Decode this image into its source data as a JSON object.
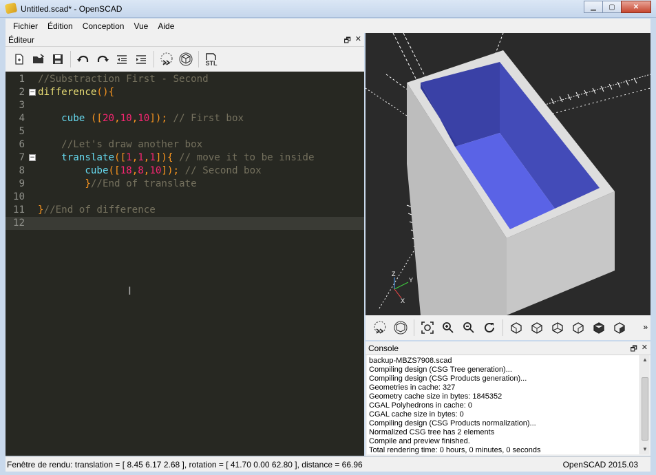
{
  "window": {
    "title": "Untitled.scad* - OpenSCAD",
    "minimize": "▁",
    "maximize": "▢",
    "close": "✕"
  },
  "menu": [
    "Fichier",
    "Édition",
    "Conception",
    "Vue",
    "Aide"
  ],
  "editor": {
    "title": "Éditeur",
    "float_icon": "🗗",
    "close_icon": "✕",
    "toolbar_icons": [
      "new-file-icon",
      "open-file-icon",
      "save-icon",
      "undo-icon",
      "redo-icon",
      "unindent-icon",
      "indent-icon",
      "preview-icon",
      "render-icon",
      "export-stl-icon"
    ],
    "stl_label": "STL",
    "lines": [
      {
        "n": "1",
        "parts": [
          [
            "c-com",
            "//Substraction First - Second"
          ]
        ]
      },
      {
        "n": "2",
        "fold": "−",
        "parts": [
          [
            "c-fn",
            "difference"
          ],
          [
            "c-br",
            "(){"
          ]
        ]
      },
      {
        "n": "3",
        "parts": []
      },
      {
        "n": "4",
        "parts": [
          [
            "c-op",
            "    "
          ],
          [
            "c-kw",
            "cube"
          ],
          [
            "c-op",
            " "
          ],
          [
            "c-br",
            "(["
          ],
          [
            "c-num",
            "20"
          ],
          [
            "c-br",
            ","
          ],
          [
            "c-num",
            "10"
          ],
          [
            "c-br",
            ","
          ],
          [
            "c-num",
            "10"
          ],
          [
            "c-br",
            "]);"
          ],
          [
            "c-op",
            " "
          ],
          [
            "c-com",
            "// First box"
          ]
        ]
      },
      {
        "n": "5",
        "parts": []
      },
      {
        "n": "6",
        "parts": [
          [
            "c-op",
            "    "
          ],
          [
            "c-com",
            "//Let's draw another box"
          ]
        ]
      },
      {
        "n": "7",
        "fold": "−",
        "parts": [
          [
            "c-op",
            "    "
          ],
          [
            "c-kw",
            "translate"
          ],
          [
            "c-br",
            "(["
          ],
          [
            "c-num",
            "1"
          ],
          [
            "c-br",
            ","
          ],
          [
            "c-num",
            "1"
          ],
          [
            "c-br",
            ","
          ],
          [
            "c-num",
            "1"
          ],
          [
            "c-br",
            "]){"
          ],
          [
            "c-op",
            " "
          ],
          [
            "c-com",
            "// move it to be inside"
          ]
        ]
      },
      {
        "n": "8",
        "parts": [
          [
            "c-op",
            "        "
          ],
          [
            "c-kw",
            "cube"
          ],
          [
            "c-br",
            "(["
          ],
          [
            "c-num",
            "18"
          ],
          [
            "c-br",
            ","
          ],
          [
            "c-num",
            "8"
          ],
          [
            "c-br",
            ","
          ],
          [
            "c-num",
            "10"
          ],
          [
            "c-br",
            "]);"
          ],
          [
            "c-op",
            " "
          ],
          [
            "c-com",
            "// Second box"
          ]
        ]
      },
      {
        "n": "9",
        "parts": [
          [
            "c-op",
            "        "
          ],
          [
            "c-br",
            "}"
          ],
          [
            "c-com",
            "//End of translate"
          ]
        ]
      },
      {
        "n": "10",
        "parts": []
      },
      {
        "n": "11",
        "parts": [
          [
            "c-br",
            "}"
          ],
          [
            "c-com",
            "//End of difference"
          ]
        ]
      },
      {
        "n": "12",
        "current": true,
        "parts": []
      }
    ]
  },
  "viewport": {
    "axis_labels": {
      "z": "Z",
      "y": "Y",
      "x": "X"
    },
    "colors": {
      "background": "#2a2a2a",
      "outer": "#c9c9c9",
      "inner": "#4a52c8",
      "grid": "#ffffff"
    },
    "toolbar_icons": [
      "preview-icon",
      "render-icon",
      "view-all-icon",
      "zoom-in-icon",
      "zoom-out-icon",
      "reset-view-icon",
      "view-right-icon",
      "view-top-icon",
      "view-bottom-icon",
      "view-left-icon",
      "view-front-icon",
      "view-back-icon"
    ],
    "more": "»"
  },
  "console": {
    "title": "Console",
    "lines": [
      "backup-MBZS7908.scad",
      "Compiling design (CSG Tree generation)...",
      "Compiling design (CSG Products generation)...",
      "Geometries in cache: 327",
      "Geometry cache size in bytes: 1845352",
      "CGAL Polyhedrons in cache: 0",
      "CGAL cache size in bytes: 0",
      "Compiling design (CSG Products normalization)...",
      "Normalized CSG tree has 2 elements",
      "Compile and preview finished.",
      "Total rendering time: 0 hours, 0 minutes, 0 seconds"
    ]
  },
  "status": {
    "left": "Fenêtre de rendu: translation = [ 8.45 6.17 2.68 ], rotation = [ 41.70 0.00 62.80 ], distance = 66.96",
    "right": "OpenSCAD 2015.03"
  }
}
